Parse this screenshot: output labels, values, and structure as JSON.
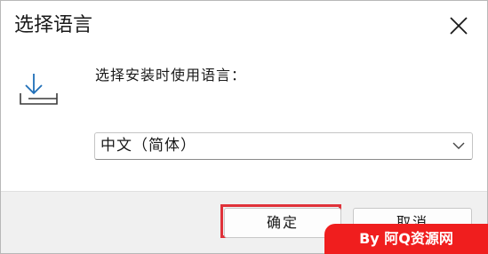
{
  "window": {
    "title": "选择语言"
  },
  "content": {
    "prompt": "选择安装时使用语言：",
    "language_select": {
      "selected": "中文（简体）"
    }
  },
  "footer": {
    "ok_label": "确定",
    "cancel_label": "取消"
  },
  "watermark": {
    "text": "By 阿Q资源网"
  },
  "icons": {
    "close": "close-icon",
    "install": "install-download-icon",
    "chevron": "chevron-down-icon"
  },
  "colors": {
    "highlight": "#e0323a",
    "watermark_bg": "#f01e1e",
    "footer_bg": "#f0f0f0"
  }
}
